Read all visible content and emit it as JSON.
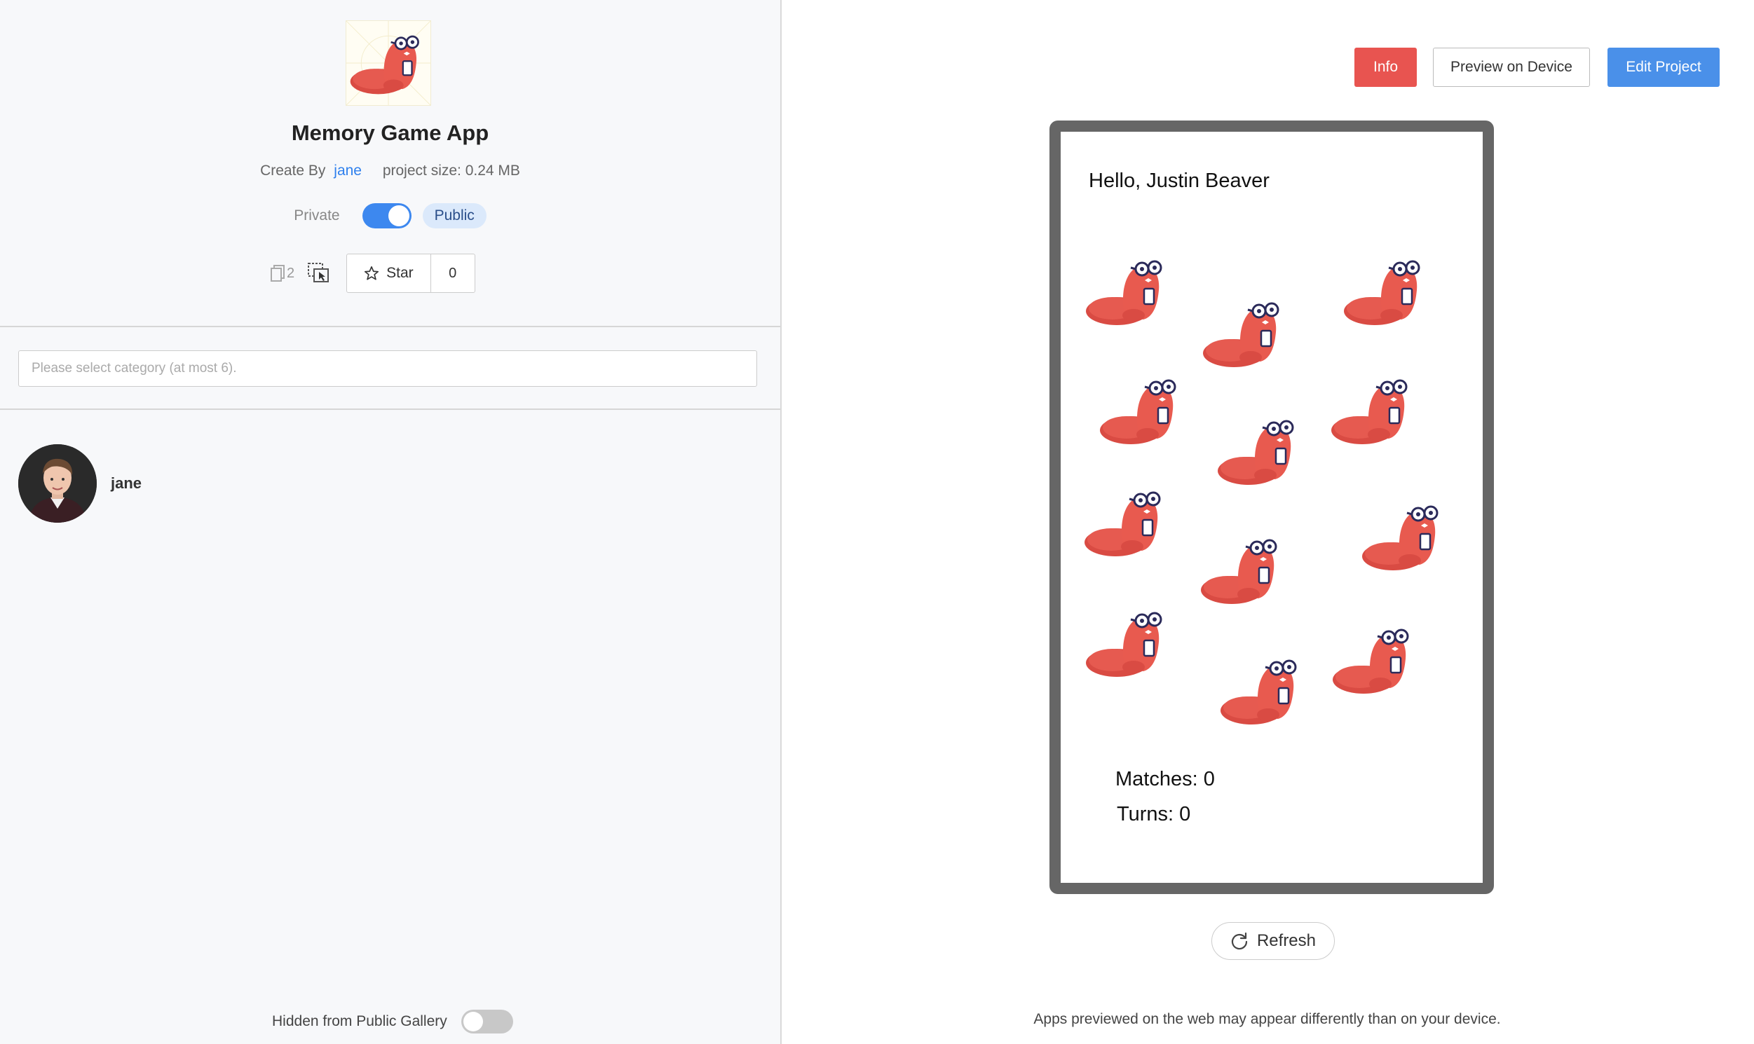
{
  "project": {
    "title": "Memory Game App",
    "created_by_label": "Create By",
    "author": "jane",
    "size_text": "project size: 0.24 MB",
    "visibility": {
      "private_label": "Private",
      "public_label": "Public",
      "is_public": true
    },
    "copies_count": "2",
    "star_label": "Star",
    "star_count": "0"
  },
  "category": {
    "placeholder": "Please select category (at most 6).",
    "value": ""
  },
  "author_card": {
    "name": "jane"
  },
  "gallery": {
    "hidden_label": "Hidden from Public Gallery",
    "hidden": false
  },
  "header_buttons": {
    "info": "Info",
    "preview": "Preview on Device",
    "edit": "Edit Project"
  },
  "preview": {
    "greeting": "Hello, Justin Beaver",
    "matches": "Matches: 0",
    "turns": "Turns: 0",
    "card_icon": "beaver-icon",
    "card_count": 12
  },
  "refresh_label": "Refresh",
  "footnote": "Apps previewed on the web may appear differently than on your device.",
  "colors": {
    "info_red": "#e85450",
    "edit_blue": "#4a90e9",
    "link_blue": "#2f80ed",
    "toggle_blue": "#3d88ef",
    "beaver_red": "#e85a4f",
    "phone_frame": "#666666"
  }
}
